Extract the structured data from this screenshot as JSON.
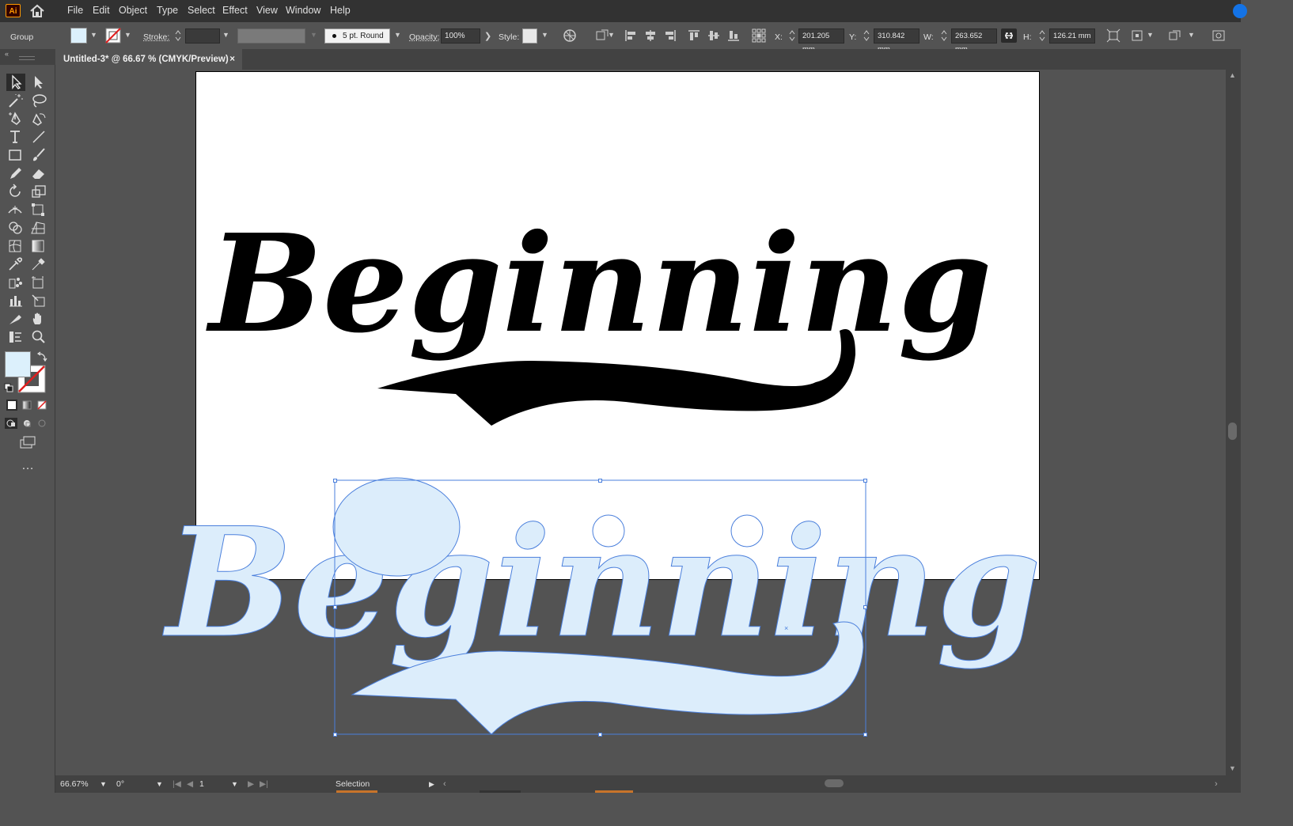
{
  "app": {
    "logo_text": "Ai"
  },
  "menu": {
    "items": [
      "File",
      "Edit",
      "Object",
      "Type",
      "Select",
      "Effect",
      "View",
      "Window",
      "Help"
    ]
  },
  "control_bar": {
    "selection_type": "Group",
    "stroke_label": "Stroke:",
    "brush_value": "5 pt. Round",
    "opacity_label": "Opacity:",
    "opacity_value": "100%",
    "style_label": "Style:",
    "x_label": "X:",
    "x_value": "201.205 mm",
    "y_label": "Y:",
    "y_value": "310.842 mm",
    "w_label": "W:",
    "w_value": "263.652 mm",
    "h_label": "H:",
    "h_value": "126.21 mm"
  },
  "document": {
    "tab_title": "Untitled-3* @ 66.67 % (CMYK/Preview)",
    "close_glyph": "×"
  },
  "artwork": {
    "word": "Beginning",
    "fill_color": "#000000",
    "selected_fill": "#dcedfb",
    "outline_color": "#4a7fdc"
  },
  "status": {
    "zoom": "66.67%",
    "rotation": "0°",
    "artboard_number": "1",
    "tool_name": "Selection"
  },
  "colors": {
    "fill_swatch": "#dcf0fc",
    "accent": "#1473e6",
    "logo_orange": "#ff9a00"
  }
}
